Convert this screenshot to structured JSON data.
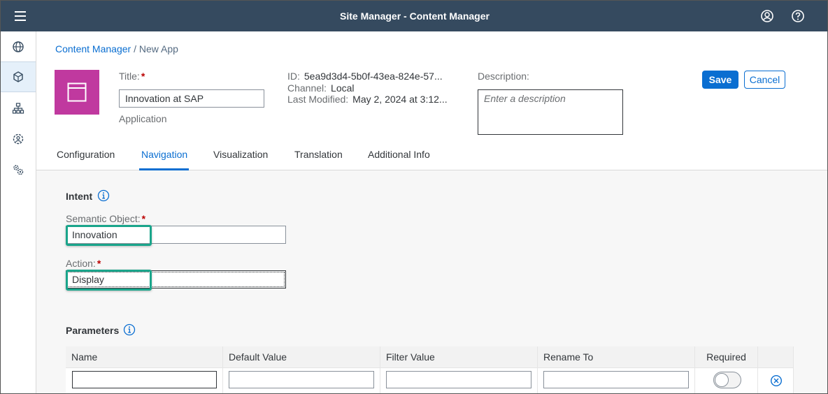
{
  "shell": {
    "title": "Site Manager - Content Manager"
  },
  "breadcrumb": {
    "link": "Content Manager",
    "separator": " / ",
    "current": "New App"
  },
  "header": {
    "title_label": "Title:",
    "title_value": "Innovation at SAP",
    "type": "Application",
    "id_label": "ID:",
    "id_value": "5ea9d3d4-5b0f-43ea-824e-57...",
    "channel_label": "Channel:",
    "channel_value": "Local",
    "modified_label": "Last Modified:",
    "modified_value": "May 2, 2024 at 3:12...",
    "description_label": "Description:",
    "description_placeholder": "Enter a description",
    "save_label": "Save",
    "cancel_label": "Cancel"
  },
  "tabs": [
    {
      "label": "Configuration"
    },
    {
      "label": "Navigation"
    },
    {
      "label": "Visualization"
    },
    {
      "label": "Translation"
    },
    {
      "label": "Additional Info"
    }
  ],
  "intent": {
    "heading": "Intent",
    "semantic_object_label": "Semantic Object:",
    "semantic_object_value": "Innovation",
    "action_label": "Action:",
    "action_value": "Display"
  },
  "parameters": {
    "heading": "Parameters",
    "columns": [
      "Name",
      "Default Value",
      "Filter Value",
      "Rename To",
      "Required"
    ]
  },
  "required_marker": "*",
  "colors": {
    "shell": "#354a5f",
    "accent": "#0a6ed1",
    "tile": "#c0399f",
    "highlight": "#1aa58b",
    "required": "#bb0000"
  }
}
